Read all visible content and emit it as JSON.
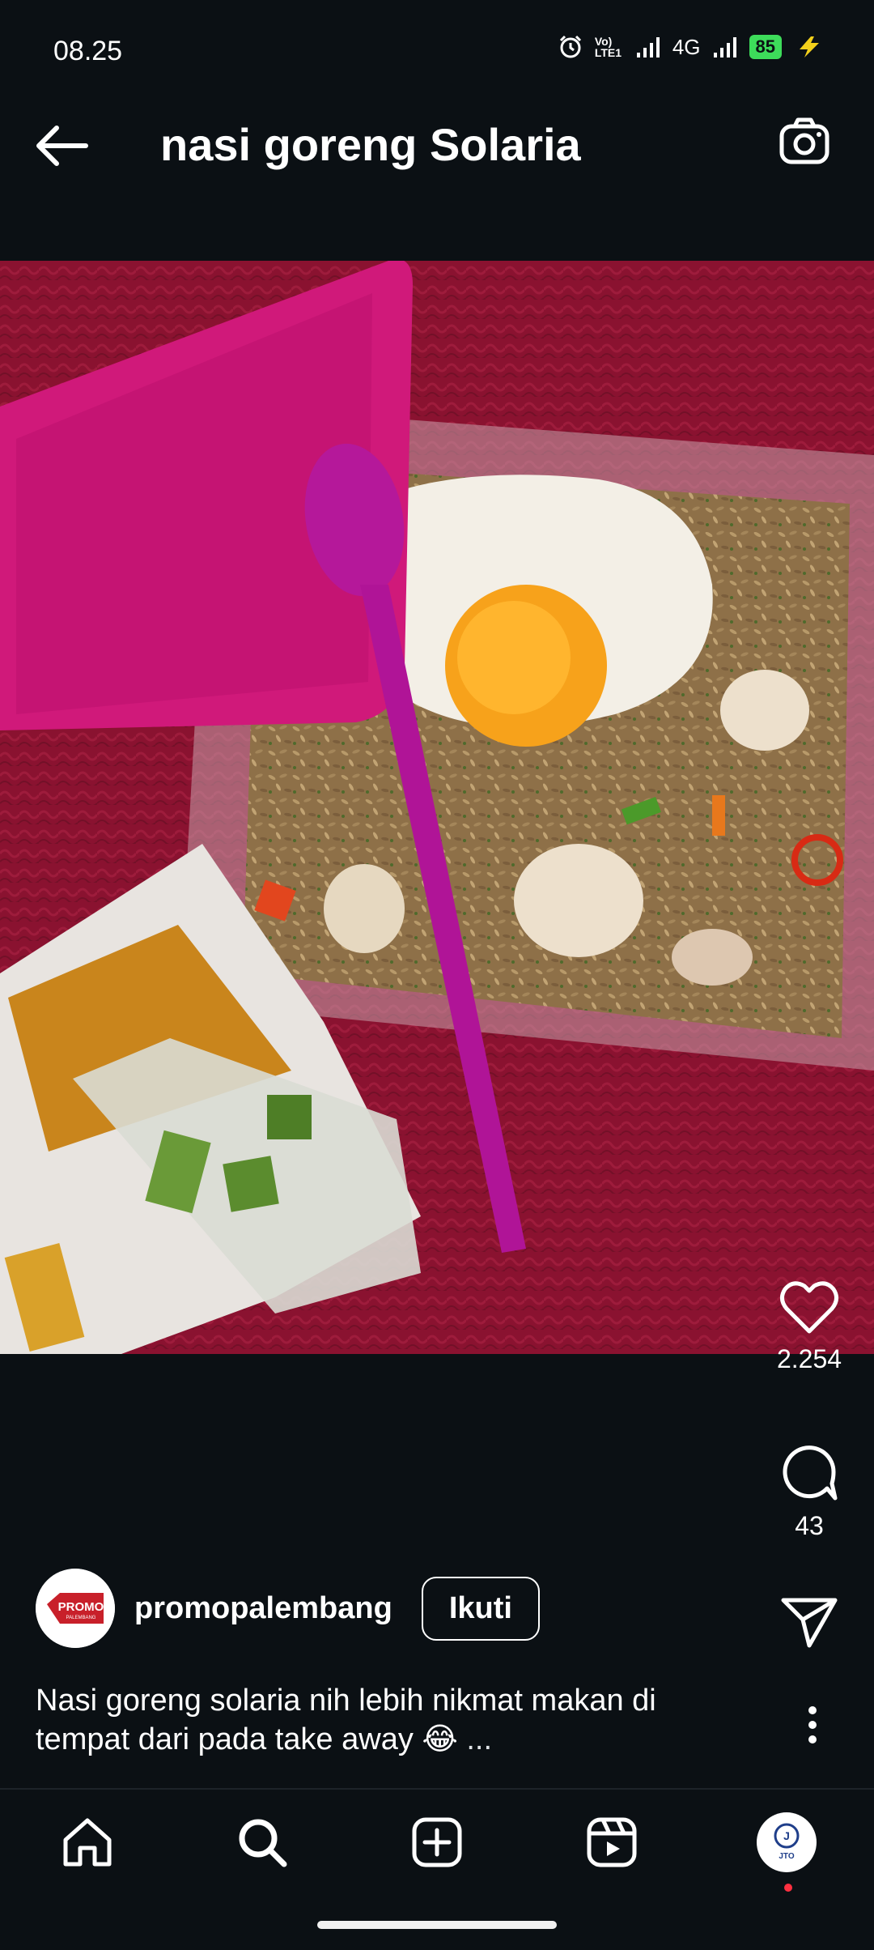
{
  "status": {
    "time": "08.25",
    "network": "4G",
    "volte": "Vo) LTE1",
    "battery": "85"
  },
  "header": {
    "title": "nasi goreng Solaria"
  },
  "post": {
    "likes": "2.254",
    "comments": "43",
    "username": "promopalembang",
    "follow_label": "Ikuti",
    "caption": "Nasi goreng solaria nih lebih nikmat makan di tempat dari pada take away 😂",
    "caption_more": "..."
  },
  "avatar_logo": {
    "line1": "PROMO",
    "line2": "PALEMBANG"
  },
  "profile_logo": {
    "text": "JTO"
  },
  "icons": {
    "back": "arrow-left-icon",
    "camera": "camera-icon",
    "like": "heart-icon",
    "comment": "comment-icon",
    "share": "paper-plane-icon",
    "more": "more-vertical-icon",
    "nav": [
      "home-icon",
      "search-icon",
      "add-post-icon",
      "reels-icon",
      "profile-avatar"
    ]
  },
  "colors": {
    "background": "#0b1014",
    "tablecloth": "#8a1230",
    "lid": "#d0197a",
    "badge": "#ff3040"
  }
}
